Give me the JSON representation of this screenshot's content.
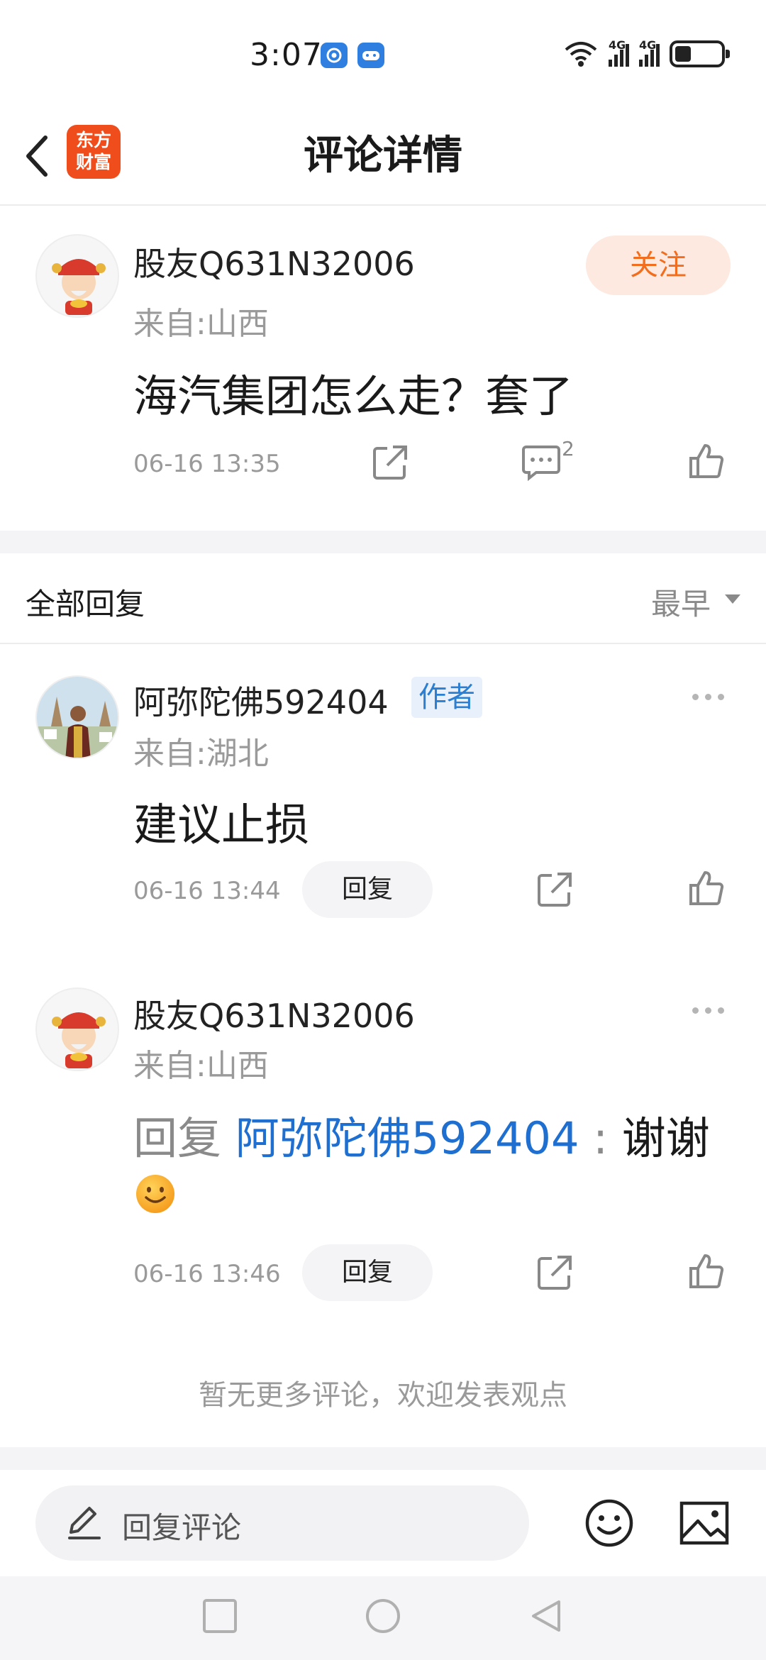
{
  "status_bar": {
    "time": "3:07",
    "signal_label_1": "4G",
    "signal_label_2": "4G",
    "wifi_label": "6"
  },
  "header": {
    "logo_line1": "东方",
    "logo_line2": "财富",
    "title": "评论详情"
  },
  "main_comment": {
    "username": "股友Q631N32006",
    "location": "来自:山西",
    "follow_label": "关注",
    "text": "海汽集团怎么走？套了",
    "time": "06-16 13:35",
    "reply_count": "2"
  },
  "replies_section": {
    "title": "全部回复",
    "sort_label": "最早"
  },
  "replies": [
    {
      "username": "阿弥陀佛592404",
      "badge": "作者",
      "location": "来自:湖北",
      "text": "建议止损",
      "time": "06-16 13:44",
      "reply_label": "回复"
    },
    {
      "username": "股友Q631N32006",
      "location": "来自:山西",
      "reply_prefix": "回复 ",
      "reply_target": "阿弥陀佛592404",
      "colon": " : ",
      "text": "谢谢",
      "time": "06-16 13:46",
      "reply_label": "回复"
    }
  ],
  "no_more_text": "暂无更多评论，欢迎发表观点",
  "input_bar": {
    "placeholder": "回复评论"
  },
  "colors": {
    "accent_orange": "#f26d1d",
    "link_blue": "#1f6fd0",
    "logo_red": "#ef4d1c"
  },
  "icons": [
    "back-arrow-icon",
    "share-icon",
    "comment-icon",
    "like-icon",
    "more-icon",
    "pen-icon",
    "emoji-icon",
    "image-icon",
    "square-nav-icon",
    "circle-nav-icon",
    "triangle-nav-icon"
  ]
}
